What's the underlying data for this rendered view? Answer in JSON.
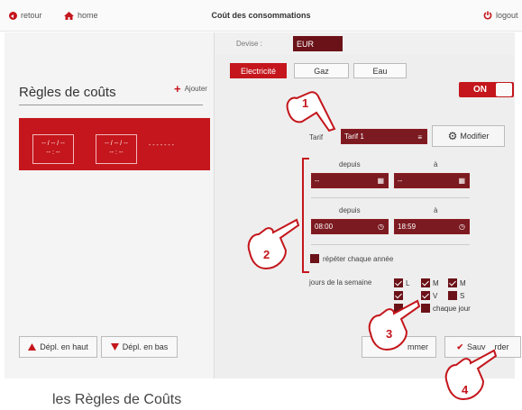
{
  "header": {
    "back_label": "retour",
    "home_label": "home",
    "title": "Coût des consommations",
    "logout_label": "logout"
  },
  "devise": {
    "label": "Devise :",
    "value": "EUR"
  },
  "energy_tabs": [
    {
      "label": "Electricité",
      "active": true
    },
    {
      "label": "Gaz",
      "active": false
    },
    {
      "label": "Eau",
      "active": false
    }
  ],
  "rules": {
    "title": "Règles de coûts",
    "add_label": "Ajouter",
    "card": {
      "dates": [
        "-- / -- / --",
        "-- / -- / --"
      ],
      "times": [
        "-- : --",
        "-- : --"
      ],
      "dots": "- - - - - - -"
    }
  },
  "toggle": {
    "label": "ON"
  },
  "tarif": {
    "label": "Tarif",
    "value": "Tarif 1",
    "modify_label": "Modifier"
  },
  "date_range": {
    "from_label": "depuis",
    "to_label": "à",
    "from_value": "--",
    "to_value": "--"
  },
  "time_range": {
    "from_label": "depuis",
    "to_label": "à",
    "from_value": "08:00",
    "to_value": "18:59"
  },
  "repeat": {
    "label": "répéter chaque année"
  },
  "days": {
    "label": "jours de la semaine",
    "items": [
      {
        "label": "L",
        "checked": true
      },
      {
        "label": "M",
        "checked": true
      },
      {
        "label": "M",
        "checked": true
      },
      {
        "label": "",
        "checked": true
      },
      {
        "label": "V",
        "checked": true
      },
      {
        "label": "S",
        "checked": false
      },
      {
        "label": "",
        "checked": false
      }
    ],
    "every_day_label": "chaque jour"
  },
  "footer": {
    "move_up_label": "Dépl. en haut",
    "move_down_label": "Dépl. en bas",
    "delete_label": "mmer",
    "save_label": "Sauv    rder"
  },
  "caption": "les Règles de Coûts",
  "callouts": [
    "1",
    "2",
    "3",
    "4"
  ],
  "colors": {
    "brand_red": "#c4161c",
    "dark_red": "#6b1218"
  }
}
